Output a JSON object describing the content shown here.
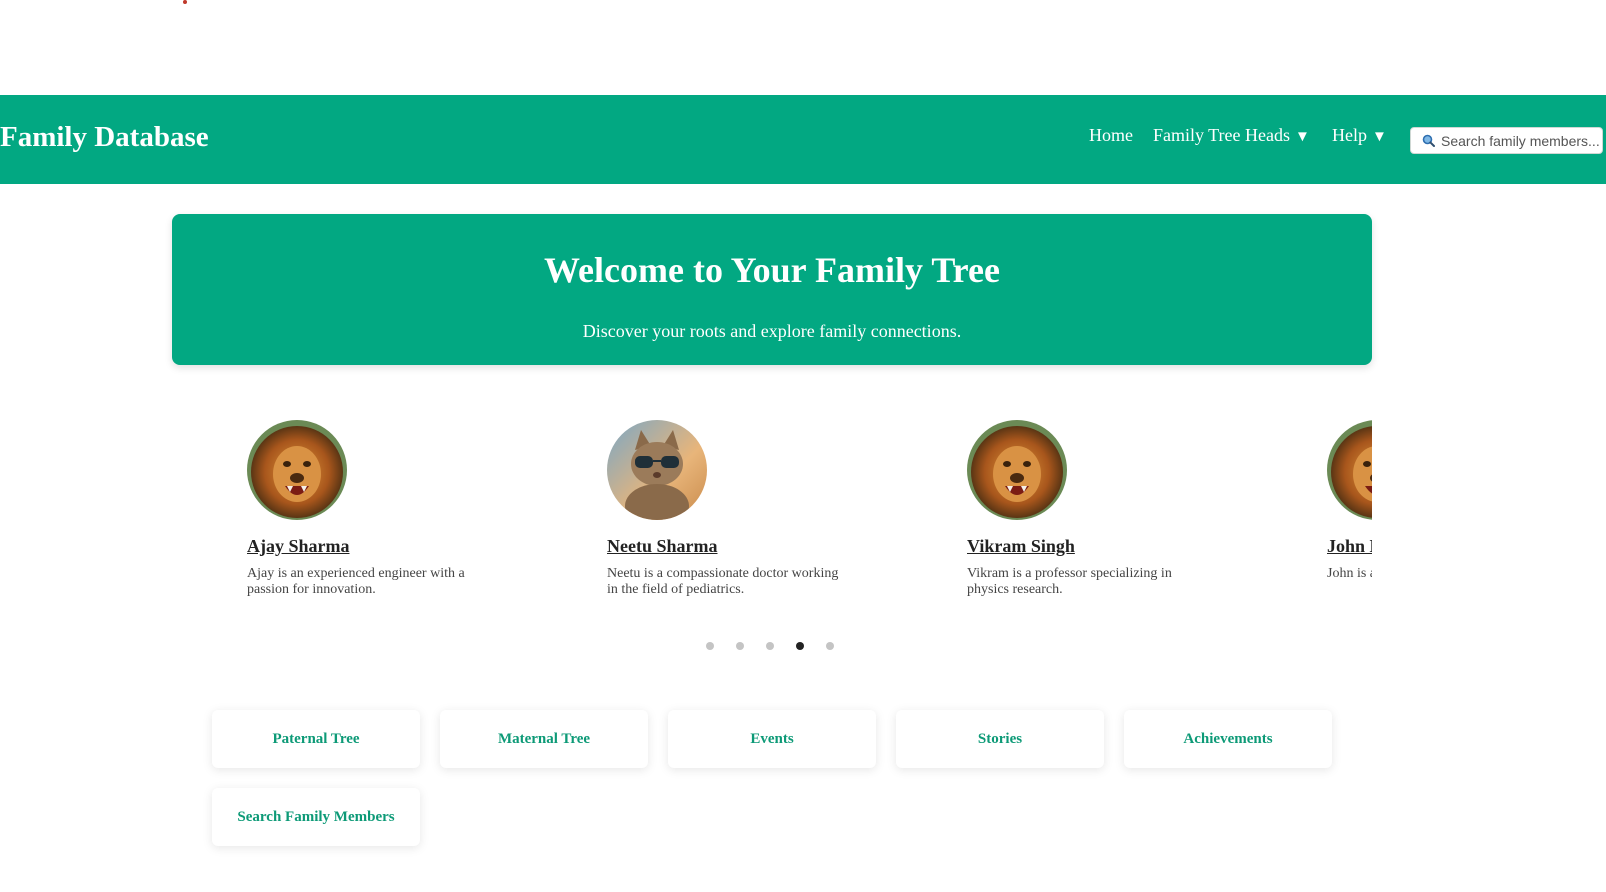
{
  "header": {
    "brand": "Family Database",
    "nav": {
      "home": "Home",
      "family_tree_heads": "Family Tree Heads",
      "help": "Help",
      "caret": "▼"
    },
    "search_placeholder": "Search family members..."
  },
  "hero": {
    "title": "Welcome to Your Family Tree",
    "subtitle": "Discover your roots and explore family connections."
  },
  "carousel": {
    "members": [
      {
        "name": "Ajay Sharma",
        "description": "Ajay is an experienced engineer with a passion for innovation.",
        "avatar": "lion"
      },
      {
        "name": "Neetu Sharma",
        "description": "Neetu is a compassionate doctor working in the field of pediatrics.",
        "avatar": "cat-with-sunglasses"
      },
      {
        "name": "Vikram Singh",
        "description": "Vikram is a professor specializing in physics research.",
        "avatar": "lion"
      },
      {
        "name": "John Doe",
        "description": "John is a passionate",
        "avatar": "lion"
      }
    ],
    "dots_total": 5,
    "active_dot": 4
  },
  "quick_links": [
    "Paternal Tree",
    "Maternal Tree",
    "Events",
    "Stories",
    "Achievements",
    "Search Family Members"
  ],
  "colors": {
    "primary": "#02a882",
    "link_text": "#0d9a77",
    "dot_active": "#222222",
    "dot_inactive": "#c4c4c4"
  }
}
